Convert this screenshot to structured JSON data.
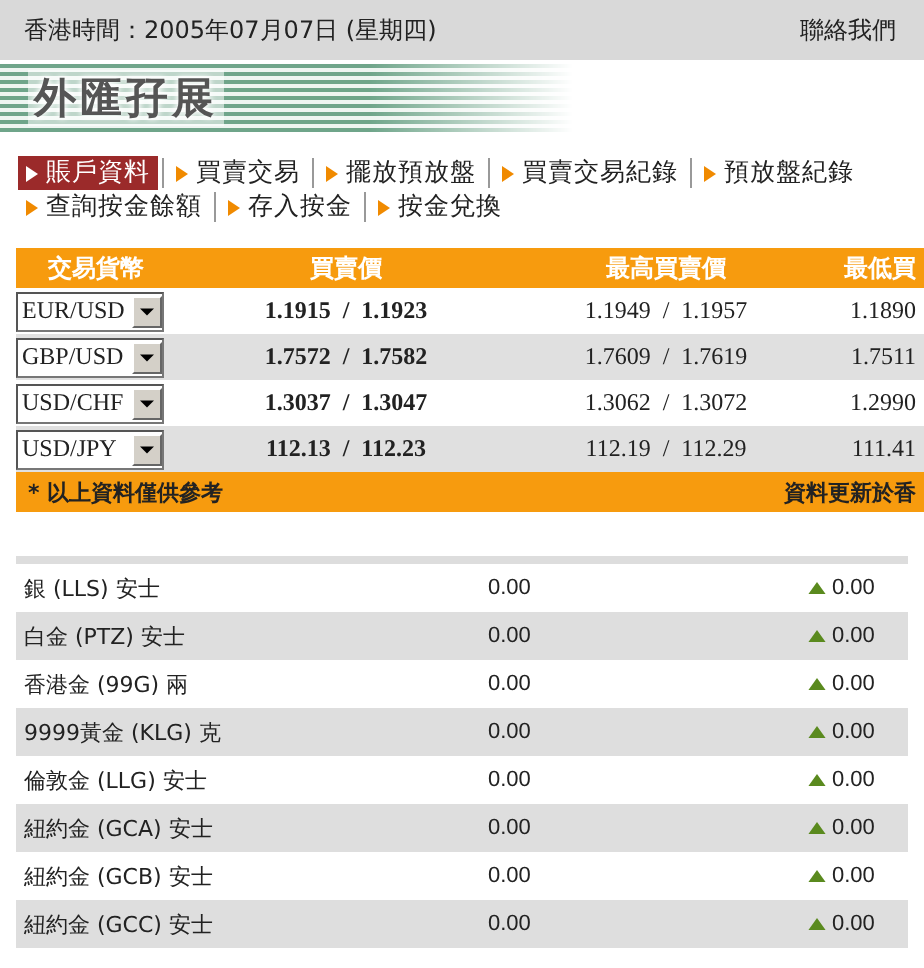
{
  "top_bar": {
    "datetime": "香港時間：2005年07月07日 (星期四)",
    "contact_link": "聯絡我們"
  },
  "title": "外匯孖展",
  "tabs": [
    {
      "label": "賬戶資料",
      "selected": true
    },
    {
      "label": "買賣交易",
      "selected": false
    },
    {
      "label": "擺放預放盤",
      "selected": false
    },
    {
      "label": "買賣交易紀錄",
      "selected": false
    },
    {
      "label": "預放盤紀錄",
      "selected": false
    },
    {
      "label": "查詢按金餘額",
      "selected": false
    },
    {
      "label": "存入按金",
      "selected": false
    },
    {
      "label": "按金兌換",
      "selected": false
    }
  ],
  "fx_table": {
    "columns": [
      "交易貨幣",
      "買賣價",
      "最高買賣價",
      "最低買"
    ],
    "rows": [
      {
        "pair": "EUR/USD",
        "bid_ask": "1.1915  /  1.1923",
        "high": "1.1949  /  1.1957",
        "low": "1.1890"
      },
      {
        "pair": "GBP/USD",
        "bid_ask": "1.7572  /  1.7582",
        "high": "1.7609  /  1.7619",
        "low": "1.7511"
      },
      {
        "pair": "USD/CHF",
        "bid_ask": "1.3037  /  1.3047",
        "high": "1.3062  /  1.3072",
        "low": "1.2990"
      },
      {
        "pair": "USD/JPY",
        "bid_ask": "112.13  /  112.23",
        "high": "112.19  /  112.29",
        "low": "111.41"
      }
    ],
    "note": "* 以上資料僅供參考",
    "updated": "資料更新於香"
  },
  "metals": [
    {
      "name": "銀 (LLS) 安士",
      "price": "0.00",
      "change": "0.00"
    },
    {
      "name": "白金 (PTZ) 安士",
      "price": "0.00",
      "change": "0.00"
    },
    {
      "name": "香港金 (99G) 兩",
      "price": "0.00",
      "change": "0.00"
    },
    {
      "name": "9999黃金 (KLG) 克",
      "price": "0.00",
      "change": "0.00"
    },
    {
      "name": "倫敦金 (LLG) 安士",
      "price": "0.00",
      "change": "0.00"
    },
    {
      "name": "紐約金 (GCA) 安士",
      "price": "0.00",
      "change": "0.00"
    },
    {
      "name": "紐約金 (GCB) 安士",
      "price": "0.00",
      "change": "0.00"
    },
    {
      "name": "紐約金 (GCC) 安士",
      "price": "0.00",
      "change": "0.00"
    }
  ]
}
